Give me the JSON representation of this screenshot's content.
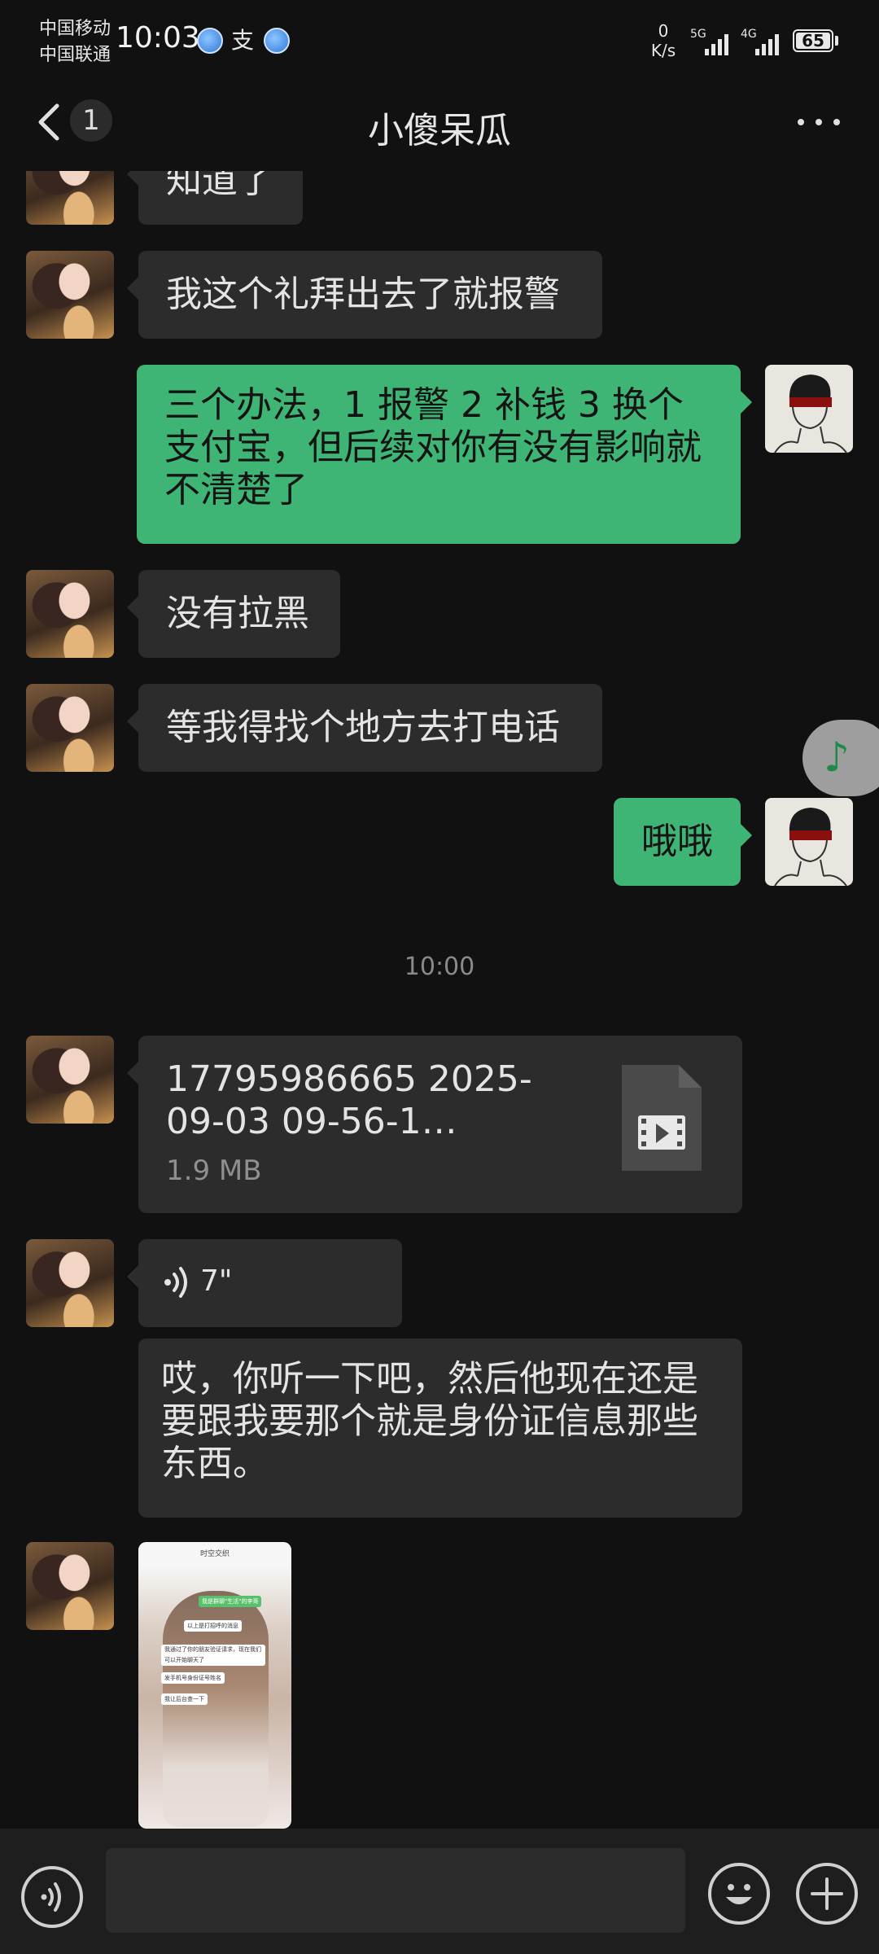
{
  "status_bar": {
    "carrier_1": "中国移动",
    "carrier_2": "中国联通",
    "time": "10:03",
    "alipay_glyph": "支",
    "net_speed_value": "0",
    "net_speed_unit": "K/s",
    "sim1_type": "5G",
    "sim2_type": "4G",
    "battery": "65"
  },
  "header": {
    "unread_count": "1",
    "title": "小傻呆瓜"
  },
  "messages": [
    {
      "side": "in",
      "type": "text",
      "text": "知道了"
    },
    {
      "side": "in",
      "type": "text",
      "text": "我这个礼拜出去了就报警"
    },
    {
      "side": "out",
      "type": "text",
      "text": "三个办法，1 报警 2 补钱 3 换个支付宝，但后续对你有没有影响就不清楚了"
    },
    {
      "side": "in",
      "type": "text",
      "text": "没有拉黑"
    },
    {
      "side": "in",
      "type": "text",
      "text": "等我得找个地方去打电话"
    },
    {
      "side": "out",
      "type": "text",
      "text": "哦哦"
    },
    {
      "type": "timestamp",
      "text": "10:00"
    },
    {
      "side": "in",
      "type": "file",
      "name": "17795986665 2025-09-03 09-56-1…",
      "size": "1.9 MB"
    },
    {
      "side": "in",
      "type": "voice",
      "duration": "7\""
    },
    {
      "side": "in",
      "type": "text",
      "text": "哎，你听一下吧，然后他现在还是要跟我要那个就是身份证信息那些东西。"
    },
    {
      "side": "in",
      "type": "image"
    }
  ],
  "thumbnail": {
    "top_title": "时空交织",
    "chip_1": "我是群聊\"生活\"的李哥",
    "chip_2": "以上是打招呼的消息",
    "chip_3": "我通过了你的朋友验证请求，现在我们可以开始聊天了",
    "chip_4": "发手机号身份证号姓名",
    "chip_5": "我让后台查一下"
  },
  "floating_music_glyph": "♪",
  "input": {
    "placeholder": ""
  },
  "colors": {
    "background": "#111111",
    "bubble_in": "#2c2c2c",
    "bubble_out": "#3eb575"
  }
}
